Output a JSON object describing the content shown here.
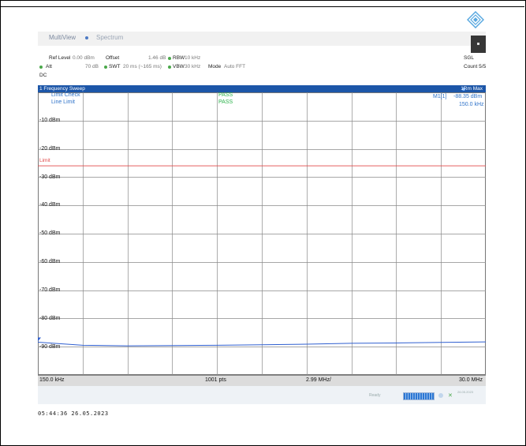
{
  "window": {
    "tabs": [
      "MultiView",
      "Spectrum"
    ]
  },
  "settings": {
    "ref_level_label": "Ref Level",
    "ref_level_value": "0.00 dBm",
    "offset_label": "Offset",
    "offset_value": "1.46 dB",
    "rbw_label": "RBW",
    "rbw_value": "10 kHz",
    "att_label": "Att",
    "att_value": "70 dB",
    "swt_label": "SWT",
    "swt_value": "20 ms (~165 ms)",
    "vbw_label": "VBW",
    "vbw_value": "30 kHz",
    "mode_label": "Mode",
    "mode_value": "Auto FFT",
    "coupling": "DC",
    "sgl": "SGL",
    "count": "Count 5/5"
  },
  "window_title": "1 Frequency Sweep",
  "trace_label": "1Rm Max",
  "limit_check": {
    "label1": "Limit Check",
    "label2": "Line Limit",
    "result1": "PASS",
    "result2": "PASS"
  },
  "marker": {
    "name": "M1[1]",
    "level": "-88.35 dBm",
    "freq": "150.0 kHz"
  },
  "limit_label": "Limit",
  "y_ticks": [
    "-10 dBm",
    "-20 dBm",
    "-30 dBm",
    "-40 dBm",
    "-50 dBm",
    "-60 dBm",
    "-70 dBm",
    "-80 dBm",
    "-90 dBm"
  ],
  "footer": {
    "start": "150.0 kHz",
    "points": "1001 pts",
    "step": "2.99 MHz/",
    "stop": "30.0 MHz"
  },
  "status": {
    "ready": "Ready",
    "progress": 1.0,
    "date_small": "26.05.2023"
  },
  "timestamp": "05:44:36  26.05.2023",
  "colors": {
    "title_bar": "#1c56a8",
    "trace": "#2f5fd0",
    "limit_line": "#e04a4a",
    "pass": "#2bb24b"
  },
  "chart_data": {
    "type": "line",
    "xlabel": "",
    "ylabel": "",
    "x_range_mhz": [
      0.15,
      30.0
    ],
    "ylim_dbm": [
      0,
      -100
    ],
    "limit_dbm": -26.0,
    "grid": true,
    "series": [
      {
        "x_mhz": [
          0.15,
          3.14,
          6.13,
          9.12,
          12.11,
          15.08,
          18.07,
          21.06,
          24.05,
          27.04,
          30.0
        ],
        "values_dbm": [
          -88.4,
          -89.5,
          -89.7,
          -89.6,
          -89.5,
          -89.3,
          -89.1,
          -88.8,
          -88.7,
          -88.5,
          -88.3
        ]
      }
    ]
  }
}
